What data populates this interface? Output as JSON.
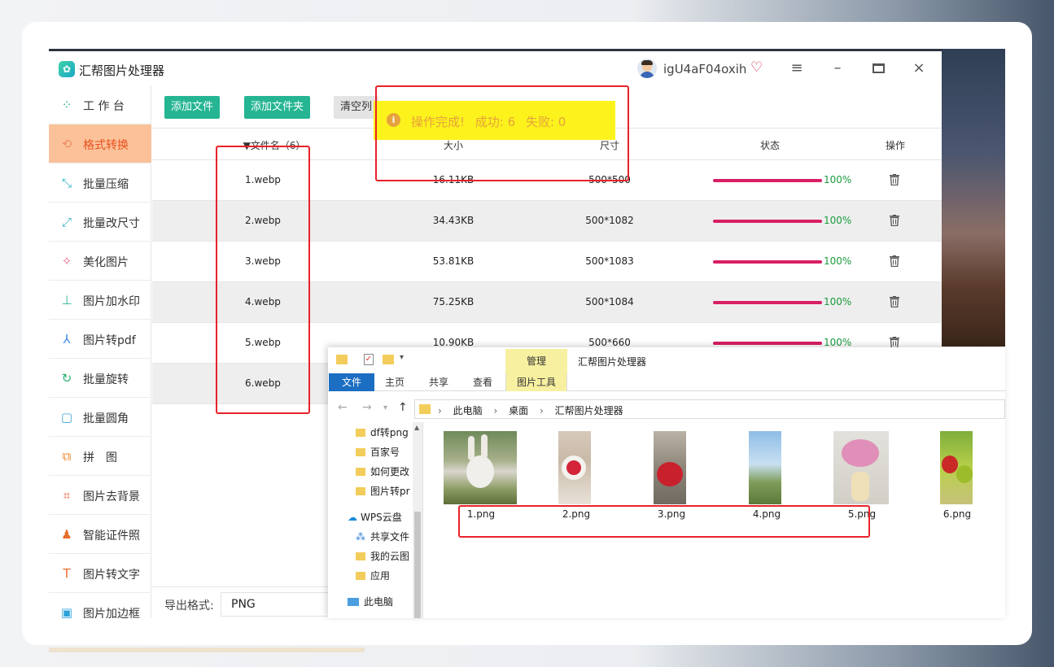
{
  "app": {
    "title": "汇帮图片处理器",
    "username": "igU4aF04oxih",
    "vip_icon": "diamond-icon",
    "window_controls": [
      "menu-icon",
      "minimize-icon",
      "maximize-icon",
      "close-icon"
    ]
  },
  "sidebar": {
    "items": [
      {
        "label": "工 作 台",
        "icon": "grid-icon"
      },
      {
        "label": "格式转换",
        "icon": "convert-icon",
        "active": true
      },
      {
        "label": "批量压缩",
        "icon": "compress-icon"
      },
      {
        "label": "批量改尺寸",
        "icon": "resize-icon"
      },
      {
        "label": "美化图片",
        "icon": "beautify-icon"
      },
      {
        "label": "图片加水印",
        "icon": "watermark-icon"
      },
      {
        "label": "图片转pdf",
        "icon": "pdf-icon"
      },
      {
        "label": "批量旋转",
        "icon": "rotate-icon"
      },
      {
        "label": "批量圆角",
        "icon": "round-corner-icon"
      },
      {
        "label": "拼　图",
        "icon": "collage-icon"
      },
      {
        "label": "图片去背景",
        "icon": "crop-icon"
      },
      {
        "label": "智能证件照",
        "icon": "person-icon"
      },
      {
        "label": "图片转文字",
        "icon": "text-icon"
      },
      {
        "label": "图片加边框",
        "icon": "frame-icon"
      }
    ]
  },
  "toolbar": {
    "add_file": "添加文件",
    "add_folder": "添加文件夹",
    "clear_list": "清空列"
  },
  "table": {
    "headers": {
      "name": "▼文件名（6）",
      "size": "大小",
      "dimension": "尺寸",
      "status": "状态",
      "action": "操作"
    },
    "rows": [
      {
        "name": "1.webp",
        "size": "16.11KB",
        "dimension": "500*500",
        "progress": "100%"
      },
      {
        "name": "2.webp",
        "size": "34.43KB",
        "dimension": "500*1082",
        "progress": "100%"
      },
      {
        "name": "3.webp",
        "size": "53.81KB",
        "dimension": "500*1083",
        "progress": "100%"
      },
      {
        "name": "4.webp",
        "size": "75.25KB",
        "dimension": "500*1084",
        "progress": "100%"
      },
      {
        "name": "5.webp",
        "size": "10.90KB",
        "dimension": "500*660",
        "progress": "100%"
      },
      {
        "name": "6.webp",
        "size": "",
        "dimension": "",
        "progress": ""
      }
    ]
  },
  "toast": {
    "message": "操作完成!",
    "success": "成功: 6",
    "fail": "失败: 0"
  },
  "export": {
    "label": "导出格式:",
    "value": "PNG"
  },
  "explorer": {
    "manage_tab": "管理",
    "title": "汇帮图片处理器",
    "tabs": {
      "file": "文件",
      "home": "主页",
      "share": "共享",
      "view": "查看",
      "picture_tools": "图片工具"
    },
    "breadcrumb": [
      "此电脑",
      "桌面",
      "汇帮图片处理器"
    ],
    "nav_items": [
      "df转png",
      "百家号",
      "如何更改",
      "图片转pr",
      "WPS云盘",
      "共享文件",
      "我的云图",
      "应用",
      "此电脑"
    ],
    "files": [
      "1.png",
      "2.png",
      "3.png",
      "4.png",
      "5.png",
      "6.png"
    ]
  },
  "colors": {
    "accent_green": "#25b593",
    "active_sidebar": "#fbc29a",
    "progress": "#d81e65",
    "toast_bg": "#fdf31c",
    "annotation": "#e8222a"
  }
}
